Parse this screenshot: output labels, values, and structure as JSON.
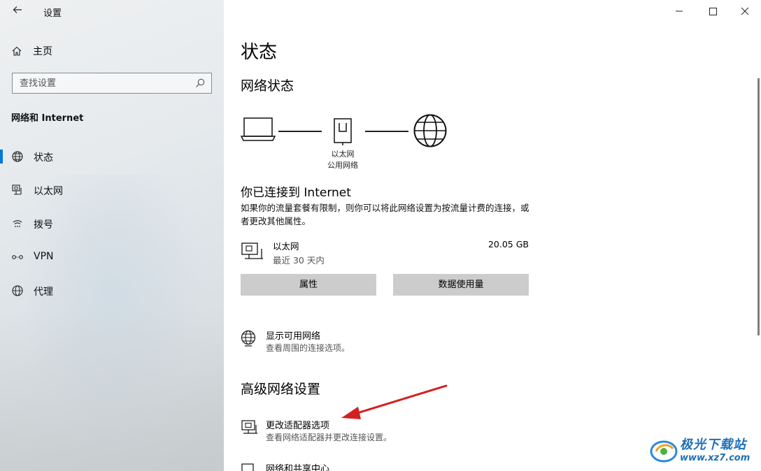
{
  "window": {
    "back_icon": "back-arrow-icon",
    "app_title": "设置",
    "controls": [
      "minimize-icon",
      "maximize-icon",
      "close-icon"
    ]
  },
  "sidebar": {
    "home_label": "主页",
    "search_placeholder": "查找设置",
    "section_title": "网络和 Internet",
    "items": [
      {
        "label": "状态",
        "icon": "globe-status-icon",
        "active": true
      },
      {
        "label": "以太网",
        "icon": "ethernet-icon",
        "active": false
      },
      {
        "label": "拨号",
        "icon": "dialup-icon",
        "active": false
      },
      {
        "label": "VPN",
        "icon": "vpn-icon",
        "active": false
      },
      {
        "label": "代理",
        "icon": "globe-proxy-icon",
        "active": false
      }
    ],
    "accent_color": "#0078d7"
  },
  "main": {
    "page_title": "状态",
    "network_status_heading": "网络状态",
    "diagram": {
      "adapter_name": "以太网",
      "network_type": "公用网络"
    },
    "connected_title": "你已连接到 Internet",
    "connected_desc": "如果你的流量套餐有限制，则你可以将此网络设置为按流量计费的连接，或者更改其他属性。",
    "usage": {
      "name": "以太网",
      "period": "最近 30 天内",
      "size": "20.05 GB"
    },
    "buttons": {
      "properties": "属性",
      "data_usage": "数据使用量"
    },
    "show_networks": {
      "title": "显示可用网络",
      "desc": "查看周围的连接选项。"
    },
    "advanced_heading": "高级网络设置",
    "change_adapter": {
      "title": "更改适配器选项",
      "desc": "查看网络适配器并更改连接设置。"
    },
    "sharing_center": {
      "title": "网络和共享中心"
    }
  },
  "watermark": {
    "brand": "极光下载站",
    "url": "www.xz7.com",
    "color": "#1f6fb8"
  },
  "annotation_arrow_color": "#d42020"
}
